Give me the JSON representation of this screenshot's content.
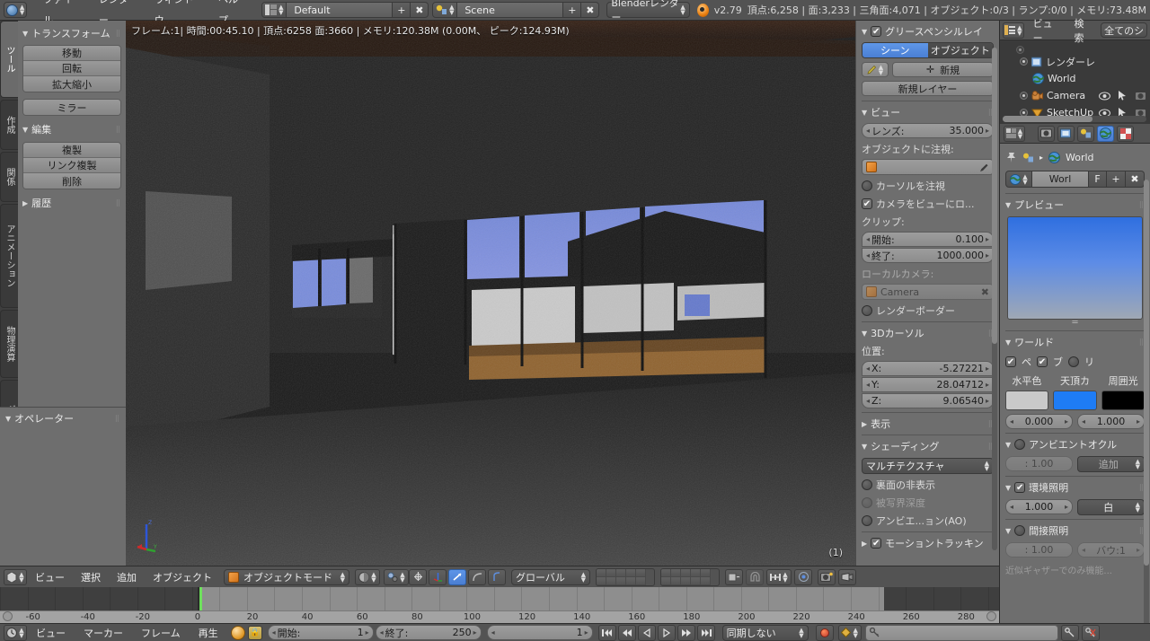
{
  "topbar": {
    "app_icon": "blender-icon",
    "menus": [
      "ファイル",
      "レンダー",
      "ウィンドウ",
      "ヘルプ"
    ],
    "screen_layout": {
      "icon": "screen-layout-icon",
      "value": "Default",
      "add": "+",
      "remove": "✖"
    },
    "scene": {
      "icon": "scene-icon",
      "value": "Scene",
      "add": "+",
      "remove": "✖"
    },
    "render_engine": "Blenderレンダー",
    "version": "v2.79",
    "stats": "頂点:6,258 | 面:3,233 | 三角面:4,071 | オブジェクト:0/3 | ランプ:0/0 | メモリ:73.48M"
  },
  "toolshelf": {
    "tabs": [
      {
        "label": "ツール",
        "active": true
      },
      {
        "label": "作成",
        "active": false
      },
      {
        "label": "関係",
        "active": false
      },
      {
        "label": "アニメーション",
        "active": false
      },
      {
        "label": "物理演算",
        "active": false
      },
      {
        "label": "グリースペンシル",
        "active": false
      }
    ],
    "panels": [
      {
        "title": "トランスフォーム",
        "open": true,
        "groups": [
          [
            "移動",
            "回転",
            "拡大縮小"
          ],
          [
            "ミラー"
          ]
        ]
      },
      {
        "title": "編集",
        "open": true,
        "groups": [
          [
            "複製",
            "リンク複製",
            "削除"
          ]
        ]
      },
      {
        "title": "履歴",
        "open": false,
        "groups": []
      }
    ],
    "operator_panel": {
      "title": "オペレーター",
      "open": true
    }
  },
  "viewport": {
    "info": "フレーム:1| 時間:00:45.10 | 頂点:6258 面:3660 | メモリ:120.38M (0.00M、 ピーク:124.93M)",
    "layer_count": "(1)",
    "axis_labels": {
      "x": "X",
      "y": "Y",
      "z": "Z"
    }
  },
  "npanel": {
    "grease_pencil": {
      "title": "グリースペンシルレイ",
      "checked": true,
      "toggle": {
        "left": "シーン",
        "right": "オブジェクト",
        "selected": "シーン"
      },
      "new_button": "新規",
      "new_layer_button": "新規レイヤー"
    },
    "view": {
      "title": "ビュー",
      "lens": {
        "label": "レンズ:",
        "value": "35.000"
      },
      "lock_to_object_label": "オブジェクトに注視:",
      "lock_object_value": "",
      "lock_cursor": {
        "label": "カーソルを注視",
        "checked": false
      },
      "lock_camera": {
        "label": "カメラをビューにロ...",
        "checked": true
      },
      "clip_label": "クリップ:",
      "clip_start": {
        "label": "開始:",
        "value": "0.100"
      },
      "clip_end": {
        "label": "終了:",
        "value": "1000.000"
      },
      "local_camera_label": "ローカルカメラ:",
      "local_camera_value": "Camera",
      "render_border": {
        "label": "レンダーボーダー",
        "checked": false
      }
    },
    "cursor3d": {
      "title": "3Dカーソル",
      "position_label": "位置:",
      "x": {
        "label": "X:",
        "value": "-5.27221"
      },
      "y": {
        "label": "Y:",
        "value": "28.04712"
      },
      "z": {
        "label": "Z:",
        "value": "9.06540"
      }
    },
    "display": {
      "title": "表示",
      "open": false
    },
    "shading": {
      "title": "シェーディング",
      "mode": "マルチテクスチャ",
      "backface_culling": {
        "label": "裏面の非表示",
        "checked": false
      },
      "depth_of_field": {
        "label": "被写界深度",
        "checked": false,
        "disabled": true
      },
      "ambient_occlusion": {
        "label": "アンビエ...ョン(AO)",
        "checked": false
      }
    },
    "motion_tracking": {
      "title": "モーショントラッキン",
      "checked": true,
      "open": false
    }
  },
  "outliner": {
    "header": {
      "display_mode_icon": "outliner-icon",
      "view_menu": "ビュー",
      "search_menu": "検索",
      "filter": "全てのシ"
    },
    "rows": [
      {
        "label": "レンダーレ",
        "icon": "renderlayer-icon",
        "indent": 1,
        "expandable": true
      },
      {
        "label": "World",
        "icon": "world-icon",
        "indent": 2,
        "expandable": false
      },
      {
        "label": "Camera",
        "icon": "camera-icon",
        "indent": 1,
        "expandable": true,
        "visibility": true
      },
      {
        "label": "SketchUp",
        "icon": "mesh-icon",
        "indent": 1,
        "expandable": true,
        "visibility": true
      }
    ]
  },
  "properties": {
    "tabs": [
      "render-icon",
      "renderlayers-icon",
      "scene-icon",
      "world-icon",
      "texture-icon"
    ],
    "active_tab": "world-icon",
    "breadcrumb": {
      "pin": "pin-icon",
      "scene_icon": "scene-icon",
      "arrow": "▸",
      "world": "World"
    },
    "id_block": {
      "icon": "world-icon",
      "name": "Worl",
      "fake_user": "F",
      "new": "+",
      "unlink": "✖"
    },
    "preview": {
      "title": "プレビュー",
      "open": true
    },
    "world": {
      "title": "ワールド",
      "toggles": [
        {
          "label": "ペ",
          "checked": true
        },
        {
          "label": "ブ",
          "checked": true
        },
        {
          "label": "リ",
          "checked": false
        }
      ],
      "columns": [
        "水平色",
        "天頂カ",
        "周囲光"
      ],
      "colors": [
        "#c9c9c9",
        "#1e7cf5",
        "#000000"
      ],
      "value_left": "0.000",
      "value_right": "1.000"
    },
    "ambient_occlusion": {
      "title": "アンビエントオクル",
      "checked": false,
      "factor": ": 1.00",
      "blend_mode": "追加"
    },
    "environment_lighting": {
      "title": "環境照明",
      "checked": true,
      "energy": "1.000",
      "source": "白"
    },
    "indirect_lighting": {
      "title": "間接照明",
      "checked": false,
      "factor": ": 1.00",
      "bounces": "バウ:1",
      "note": "近似ギャザーでのみ機能..."
    }
  },
  "viewport_footer": {
    "editor_icon": "editor-type-icon",
    "menus": [
      "ビュー",
      "選択",
      "追加",
      "オブジェクト"
    ],
    "mode": "オブジェクトモード",
    "viewport_shading": "solid-shading-icon",
    "pivot": "median-point-icon",
    "manipulator_icons": [
      "translate-manipulator-icon",
      "rotate-manipulator-icon",
      "scale-manipulator-icon"
    ],
    "transform_orientation": "グローバル",
    "snap_icon": "magnet-icon",
    "proportional_icon": "proportional-edit-icon",
    "render_icons": [
      "render-preview-icon",
      "render-opengl-icon"
    ]
  },
  "timeline": {
    "ticks": [
      "-60",
      "-40",
      "-20",
      "0",
      "20",
      "40",
      "60",
      "80",
      "100",
      "120",
      "140",
      "160",
      "180",
      "200",
      "220",
      "240",
      "260",
      "280"
    ],
    "current_frame": 1,
    "range_start": 0,
    "range_end": 250,
    "view_min": -72,
    "view_max": 292
  },
  "timeline_footer": {
    "editor_icon": "timeline-editor-icon",
    "menus": [
      "ビュー",
      "マーカー",
      "フレーム",
      "再生"
    ],
    "clock_icon": "clock-icon",
    "lock_icon": "lock-icon",
    "start": {
      "label": "開始:",
      "value": "1"
    },
    "end": {
      "label": "終了:",
      "value": "250"
    },
    "current": {
      "value": "1"
    },
    "transport": [
      "jump-start-icon",
      "play-reverse-icon",
      "step-back-icon",
      "play-icon",
      "step-forward-icon",
      "jump-end-icon"
    ],
    "sync_mode": "同期しない",
    "record_icon": "record-icon",
    "keyingset_icon": "keyframe-icon",
    "keyingset_value": "",
    "keyframe_insert_icon": "key-insert-icon",
    "keyframe_delete_icon": "key-delete-icon"
  }
}
